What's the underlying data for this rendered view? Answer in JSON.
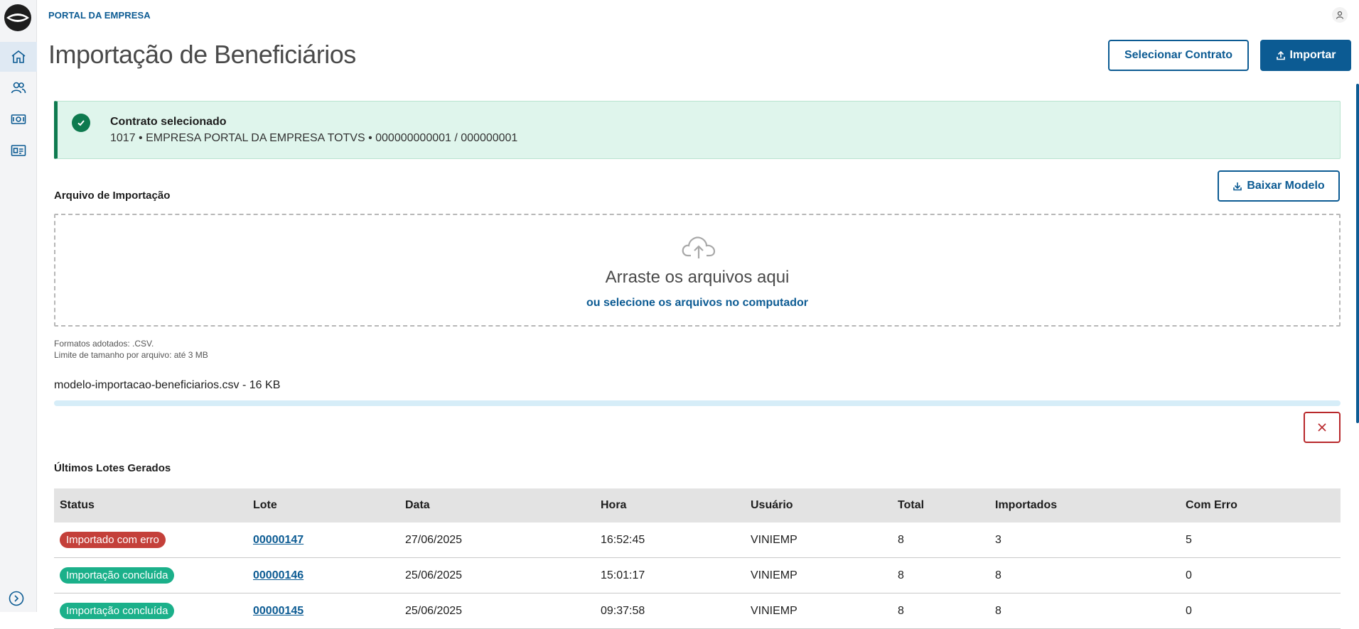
{
  "header": {
    "portal_label": "PORTAL DA EMPRESA",
    "page_title": "Importação de Beneficiários",
    "select_contract_label": "Selecionar Contrato",
    "import_label": "Importar"
  },
  "sidebar": {
    "items": [
      {
        "icon": "home-icon",
        "active": true
      },
      {
        "icon": "users-icon",
        "active": false
      },
      {
        "icon": "money-icon",
        "active": false
      },
      {
        "icon": "id-card-icon",
        "active": false
      }
    ]
  },
  "alert": {
    "title": "Contrato selecionado",
    "description": "1017 • EMPRESA PORTAL DA EMPRESA TOTVS • 000000000001 / 000000001"
  },
  "upload": {
    "section_label": "Arquivo de Importação",
    "download_template_label": "Baixar Modelo",
    "drop_title": "Arraste os arquivos aqui",
    "drop_link": "ou selecione os arquivos no computador",
    "formats_hint": "Formatos adotados: .CSV.",
    "size_hint": "Limite de tamanho por arquivo: até 3 MB",
    "file_name": "modelo-importacao-beneficiarios.csv - 16 KB",
    "progress_fraction": 1.0
  },
  "batches": {
    "section_label": "Últimos Lotes Gerados",
    "columns": [
      "Status",
      "Lote",
      "Data",
      "Hora",
      "Usuário",
      "Total",
      "Importados",
      "Com Erro"
    ],
    "rows": [
      {
        "status": "Importado com erro",
        "status_color": "#c4403a",
        "lote": "00000147",
        "data": "27/06/2025",
        "hora": "16:52:45",
        "usuario": "VINIEMP",
        "total": "8",
        "importados": "3",
        "com_erro": "5"
      },
      {
        "status": "Importação concluída",
        "status_color": "#1bb08a",
        "lote": "00000146",
        "data": "25/06/2025",
        "hora": "15:01:17",
        "usuario": "VINIEMP",
        "total": "8",
        "importados": "8",
        "com_erro": "0"
      },
      {
        "status": "Importação concluída",
        "status_color": "#1bb08a",
        "lote": "00000145",
        "data": "25/06/2025",
        "hora": "09:37:58",
        "usuario": "VINIEMP",
        "total": "8",
        "importados": "8",
        "com_erro": "0"
      }
    ]
  },
  "colors": {
    "brand": "#0c5b93",
    "success": "#0e7a4f",
    "danger": "#b8282b"
  }
}
